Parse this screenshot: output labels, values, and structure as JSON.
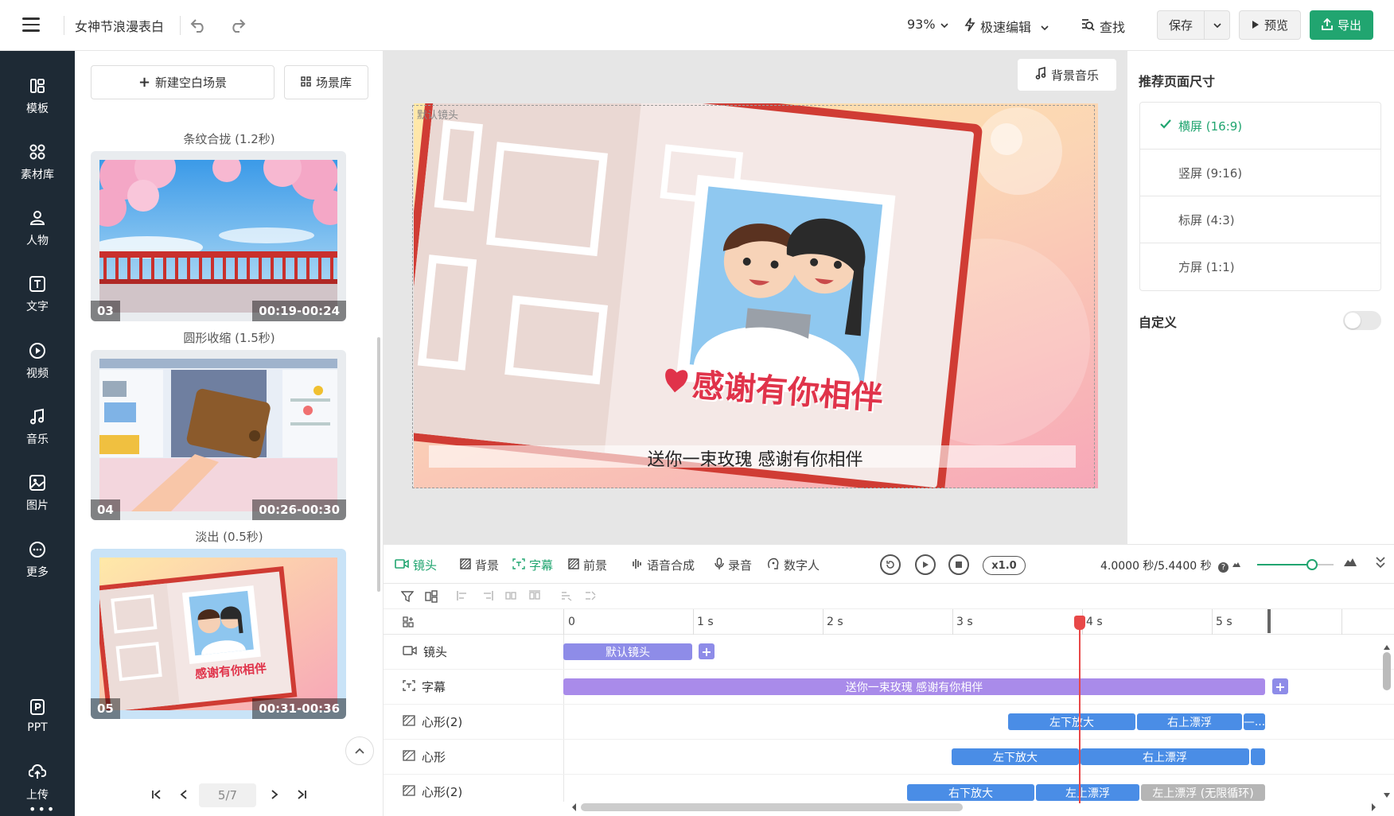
{
  "header": {
    "project_title": "女神节浪漫表白",
    "zoom": "93%",
    "mode": "极速编辑",
    "find": "查找",
    "save": "保存",
    "preview": "预览",
    "export": "导出"
  },
  "sidebar": {
    "items": [
      {
        "label": "模板",
        "icon": "template-icon"
      },
      {
        "label": "素材库",
        "icon": "assets-icon"
      },
      {
        "label": "人物",
        "icon": "person-icon"
      },
      {
        "label": "文字",
        "icon": "text-icon"
      },
      {
        "label": "视频",
        "icon": "video-icon"
      },
      {
        "label": "音乐",
        "icon": "music-icon"
      },
      {
        "label": "图片",
        "icon": "image-icon"
      },
      {
        "label": "更多",
        "icon": "more-icon"
      },
      {
        "label": "PPT",
        "icon": "ppt-icon"
      },
      {
        "label": "上传",
        "icon": "upload-icon"
      }
    ]
  },
  "scenes": {
    "new_blank": "新建空白场景",
    "library": "场景库",
    "transitions": [
      "条纹合拢 (1.2秒)",
      "圆形收缩 (1.5秒)",
      "淡出 (0.5秒)"
    ],
    "cards": [
      {
        "num": "03",
        "time": "00:19-00:24"
      },
      {
        "num": "04",
        "time": "00:26-00:30"
      },
      {
        "num": "05",
        "time": "00:31-00:36"
      }
    ],
    "pager": "5/7",
    "card05_caption": "感谢有你相伴"
  },
  "canvas": {
    "bgm": "背景音乐",
    "stage_label": "默认镜头",
    "headline": "感谢有你相伴",
    "subtitle": "送你一束玫瑰 感谢有你相伴"
  },
  "right_panel": {
    "title": "推荐页面尺寸",
    "sizes": [
      "横屏 (16:9)",
      "竖屏 (9:16)",
      "标屏 (4:3)",
      "方屏 (1:1)"
    ],
    "selected_index": 0,
    "custom": "自定义",
    "custom_enabled": false
  },
  "timeline": {
    "tabs": [
      "镜头",
      "背景",
      "字幕",
      "前景",
      "语音合成",
      "录音",
      "数字人"
    ],
    "speed": "x1.0",
    "time": "4.0000 秒/5.4400 秒",
    "zoom_level": 0.7,
    "ruler": [
      "0",
      "1 s",
      "2 s",
      "3 s",
      "4 s",
      "5 s"
    ],
    "tracks": [
      {
        "label": "镜头",
        "clips": [
          "默认镜头"
        ]
      },
      {
        "label": "字幕",
        "clips": [
          "送你一束玫瑰 感谢有你相伴"
        ]
      },
      {
        "label": "心形(2)",
        "clips": [
          "左下放大",
          "右上漂浮",
          "—..."
        ]
      },
      {
        "label": "心形",
        "clips": [
          "左下放大",
          "右上漂浮"
        ]
      },
      {
        "label": "心形(2)",
        "clips": [
          "右下放大",
          "左上漂浮",
          "左上漂浮 (无限循环)"
        ]
      }
    ]
  },
  "colors": {
    "accent": "#21a570",
    "sidebar_bg": "#1e2a35",
    "clip_purple": "#8e8ce8",
    "clip_blue": "#4a8de6",
    "playhead": "#e84848"
  }
}
